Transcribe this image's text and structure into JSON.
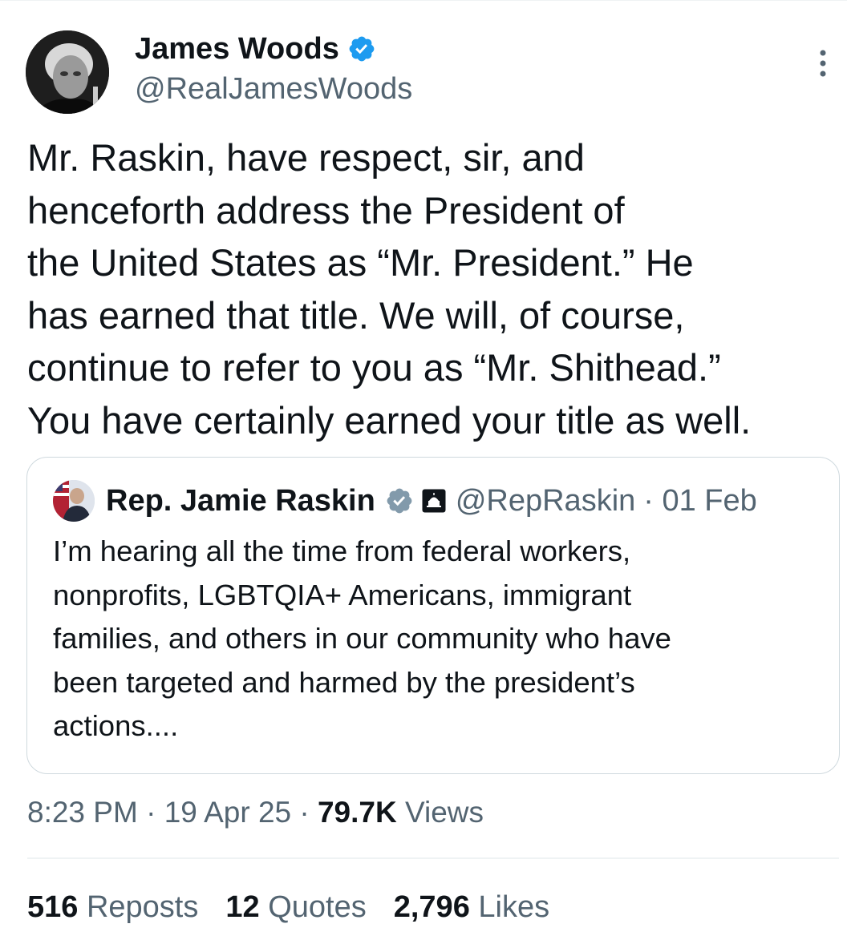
{
  "author": {
    "name": "James Woods",
    "handle": "@RealJamesWoods",
    "verified_color": "#1d9bf0",
    "avatar_icon": "author-avatar"
  },
  "tweet": {
    "text": "Mr. Raskin, have respect, sir, and\nhenceforth address the President of\nthe United States as “Mr. President.” He\nhas earned that title. We will, of course,\ncontinue to refer to you as “Mr. Shithead.”\nYou have certainly earned your title as well."
  },
  "quoted": {
    "name": "Rep. Jamie Raskin",
    "handle": "@RepRaskin",
    "date": "· 01 Feb",
    "badge_color": "#829aab",
    "text": "I’m hearing all the time from federal workers,\nnonprofits, LGBTQIA+ Americans, immigrant\nfamilies, and others in our community who have\nbeen targeted and harmed by the president’s\nactions...."
  },
  "meta": {
    "time": "8:23 PM",
    "sep1": " · ",
    "date": "19 Apr 25",
    "sep2": " · ",
    "views_count": "79.7K",
    "views_label": " Views"
  },
  "stats": [
    {
      "count": "516",
      "label": " Reposts"
    },
    {
      "count": "12",
      "label": " Quotes"
    },
    {
      "count": "2,796",
      "label": " Likes"
    }
  ]
}
